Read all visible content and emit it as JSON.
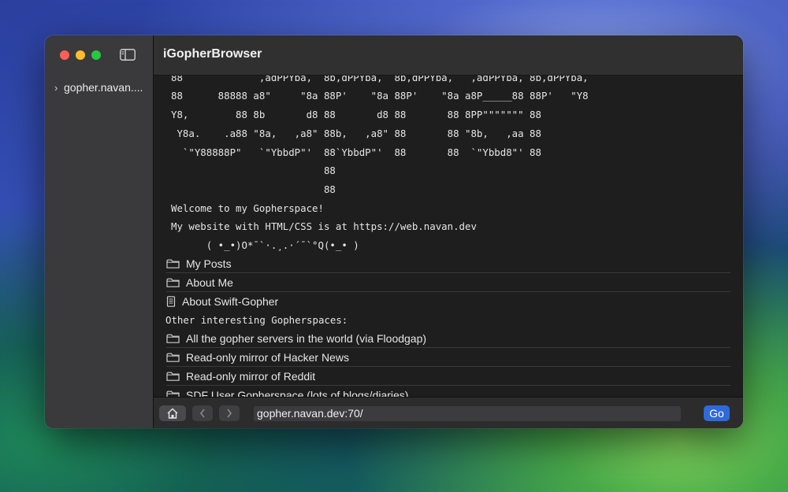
{
  "window": {
    "title": "iGopherBrowser"
  },
  "sidebar": {
    "items": [
      {
        "label": "gopher.navan...."
      }
    ]
  },
  "ascii_art": [
    "88             ,adPPYba,  8b,dPPYba,  8b,dPPYba,   ,adPPYba, 8b,dPPYba,",
    "88      88888 a8\"     \"8a 88P'    \"8a 88P'    \"8a a8P_____88 88P'   \"Y8",
    "Y8,        88 8b       d8 88       d8 88       88 8PP\"\"\"\"\"\"\" 88",
    " Y8a.    .a88 \"8a,   ,a8\" 88b,   ,a8\" 88       88 \"8b,   ,aa 88",
    "  `\"Y88888P\"   `\"YbbdP\"'  88`YbbdP\"'  88       88  `\"Ybbd8\"' 88",
    "                          88",
    "                          88"
  ],
  "info_lines": [
    "Welcome to my Gopherspace!",
    "My website with HTML/CSS is at https://web.navan.dev",
    "      ( •_•)O*¯`·.¸.·´¯`°Q(•_• )"
  ],
  "links": [
    {
      "label": "My Posts",
      "icon": "folder-icon"
    },
    {
      "label": "About Me",
      "icon": "folder-icon"
    },
    {
      "label": "About Swift-Gopher",
      "icon": "document-icon"
    }
  ],
  "section_heading": "Other interesting Gopherspaces:",
  "links2": [
    {
      "label": "All the gopher servers in the world (via Floodgap)",
      "icon": "folder-icon"
    },
    {
      "label": "Read-only mirror of Hacker News",
      "icon": "folder-icon"
    },
    {
      "label": "Read-only mirror of Reddit",
      "icon": "folder-icon"
    },
    {
      "label": "SDF User Gopherspace (lots of blogs/diaries)",
      "icon": "folder-icon"
    }
  ],
  "toolbar": {
    "url": "gopher.navan.dev:70/",
    "go_label": "Go"
  },
  "colors": {
    "accent": "#2f6ad9",
    "close": "#ff5f57",
    "minimize": "#febc2e",
    "maximize": "#28c840"
  }
}
